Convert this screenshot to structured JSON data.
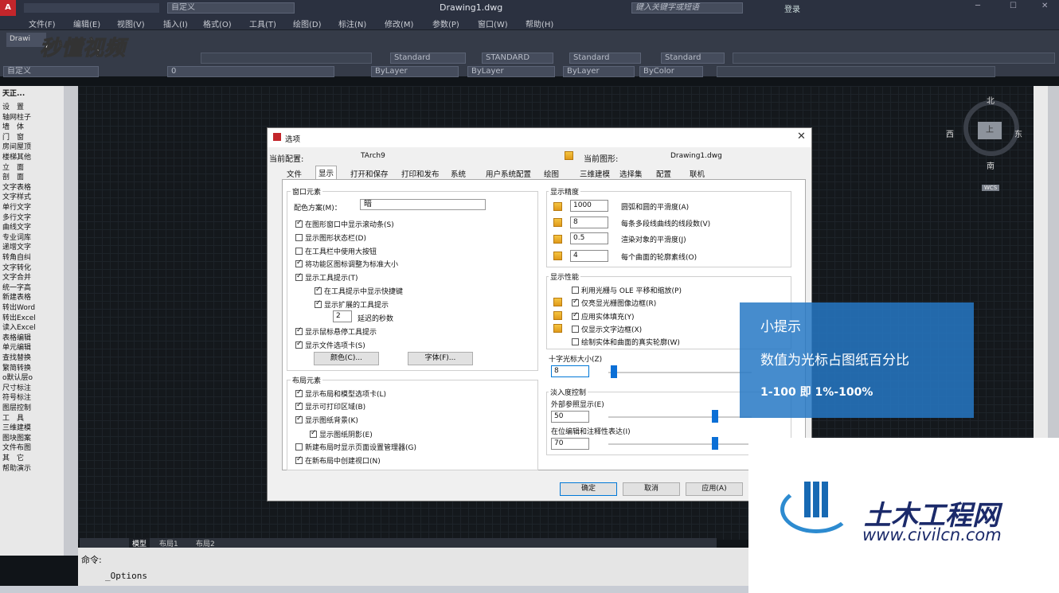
{
  "app": {
    "title": "Drawing1.dwg",
    "workspace": "自定义",
    "search_placeholder": "键入关键字或短语",
    "login": "登录",
    "doc_tab": "Drawi"
  },
  "menu": [
    "文件(F)",
    "编辑(E)",
    "视图(V)",
    "插入(I)",
    "格式(O)",
    "工具(T)",
    "绘图(D)",
    "标注(N)",
    "修改(M)",
    "参数(P)",
    "窗口(W)",
    "帮助(H)"
  ],
  "toolbar": {
    "text_style": "Standard",
    "dim_style": "STANDARD",
    "table_style": "Standard",
    "mleader_style": "Standard",
    "ws_combo": "自定义",
    "layer": "0",
    "color": "ByLayer",
    "linetype": "ByLayer",
    "lineweight": "ByLayer",
    "plotstyle": "ByColor"
  },
  "watermark": {
    "brand": "秒懂视频"
  },
  "left_panel": {
    "title": "天正...",
    "items": [
      "设　置",
      "轴网柱子",
      "墙　体",
      "门　窗",
      "房间屋顶",
      "楼梯其他",
      "立　面",
      "剖　面",
      "文字表格",
      "文字样式",
      "单行文字",
      "多行文字",
      "曲线文字",
      "专业词库",
      "递增文字",
      "转角自纠",
      "文字转化",
      "文字合并",
      "统一字高",
      "新建表格",
      "转出Word",
      "转出Excel",
      "读入Excel",
      "表格编辑",
      "单元编辑",
      "查找替换",
      "繁简转换",
      "o默认层o",
      "尺寸标注",
      "符号标注",
      "图层控制",
      "工　具",
      "三维建模",
      "图块图案",
      "文件布图",
      "其　它",
      "帮助演示"
    ]
  },
  "layout_tabs": [
    "模型",
    "布局1",
    "布局2"
  ],
  "command": {
    "label": "命令:",
    "input": "_Options"
  },
  "compass": {
    "n": "北",
    "s": "南",
    "e": "东",
    "w": "西",
    "top": "上",
    "wcs": "WCS"
  },
  "dialog": {
    "title": "选项",
    "current_profile_label": "当前配置:",
    "current_profile": "TArch9",
    "current_drawing_label": "当前图形:",
    "current_drawing": "Drawing1.dwg",
    "tabs": [
      "文件",
      "显示",
      "打开和保存",
      "打印和发布",
      "系统",
      "用户系统配置",
      "绘图",
      "三维建模",
      "选择集",
      "配置",
      "联机"
    ],
    "window_elements": {
      "title": "窗口元素",
      "scheme_label": "配色方案(M)：",
      "scheme_value": "暗",
      "checks": [
        "在图形窗口中显示滚动条(S)",
        "显示图形状态栏(D)",
        "在工具栏中使用大按钮",
        "将功能区图标调整为标准大小",
        "显示工具提示(T)",
        "在工具提示中显示快捷键",
        "显示扩展的工具提示",
        "延迟的秒数",
        "显示鼠标悬停工具提示",
        "显示文件选项卡(S)"
      ],
      "delay_value": "2",
      "colors_btn": "颜色(C)...",
      "fonts_btn": "字体(F)..."
    },
    "layout_elements": {
      "title": "布局元素",
      "checks": [
        "显示布局和模型选项卡(L)",
        "显示可打印区域(B)",
        "显示图纸背景(K)",
        "显示图纸阴影(E)",
        "新建布局时显示页面设置管理器(G)",
        "在新布局中创建视口(N)"
      ]
    },
    "resolution": {
      "title": "显示精度",
      "rows": [
        {
          "value": "1000",
          "label": "圆弧和圆的平滑度(A)"
        },
        {
          "value": "8",
          "label": "每条多段线曲线的线段数(V)"
        },
        {
          "value": "0.5",
          "label": "渲染对象的平滑度(J)"
        },
        {
          "value": "4",
          "label": "每个曲面的轮廓素线(O)"
        }
      ]
    },
    "performance": {
      "title": "显示性能",
      "checks": [
        "利用光栅与 OLE 平移和缩放(P)",
        "仅亮显光栅图像边框(R)",
        "应用实体填充(Y)",
        "仅显示文字边框(X)",
        "绘制实体和曲面的真实轮廓(W)"
      ]
    },
    "crosshair": {
      "title": "十字光标大小(Z)",
      "value": "8",
      "level": 8
    },
    "fade": {
      "title": "淡入度控制",
      "xref_label": "外部参照显示(E)",
      "xref_value": "50",
      "inplace_label": "在位编辑和注释性表达(I)",
      "inplace_value": "70"
    },
    "buttons": {
      "ok": "确定",
      "cancel": "取消",
      "apply": "应用(A)"
    }
  },
  "tip": {
    "title": "小提示",
    "line1": "数值为光标占图纸百分比",
    "line2": "1-100 即 1%-100%"
  },
  "logo": {
    "name": "土木工程网",
    "url": "www.civilcn.com"
  }
}
